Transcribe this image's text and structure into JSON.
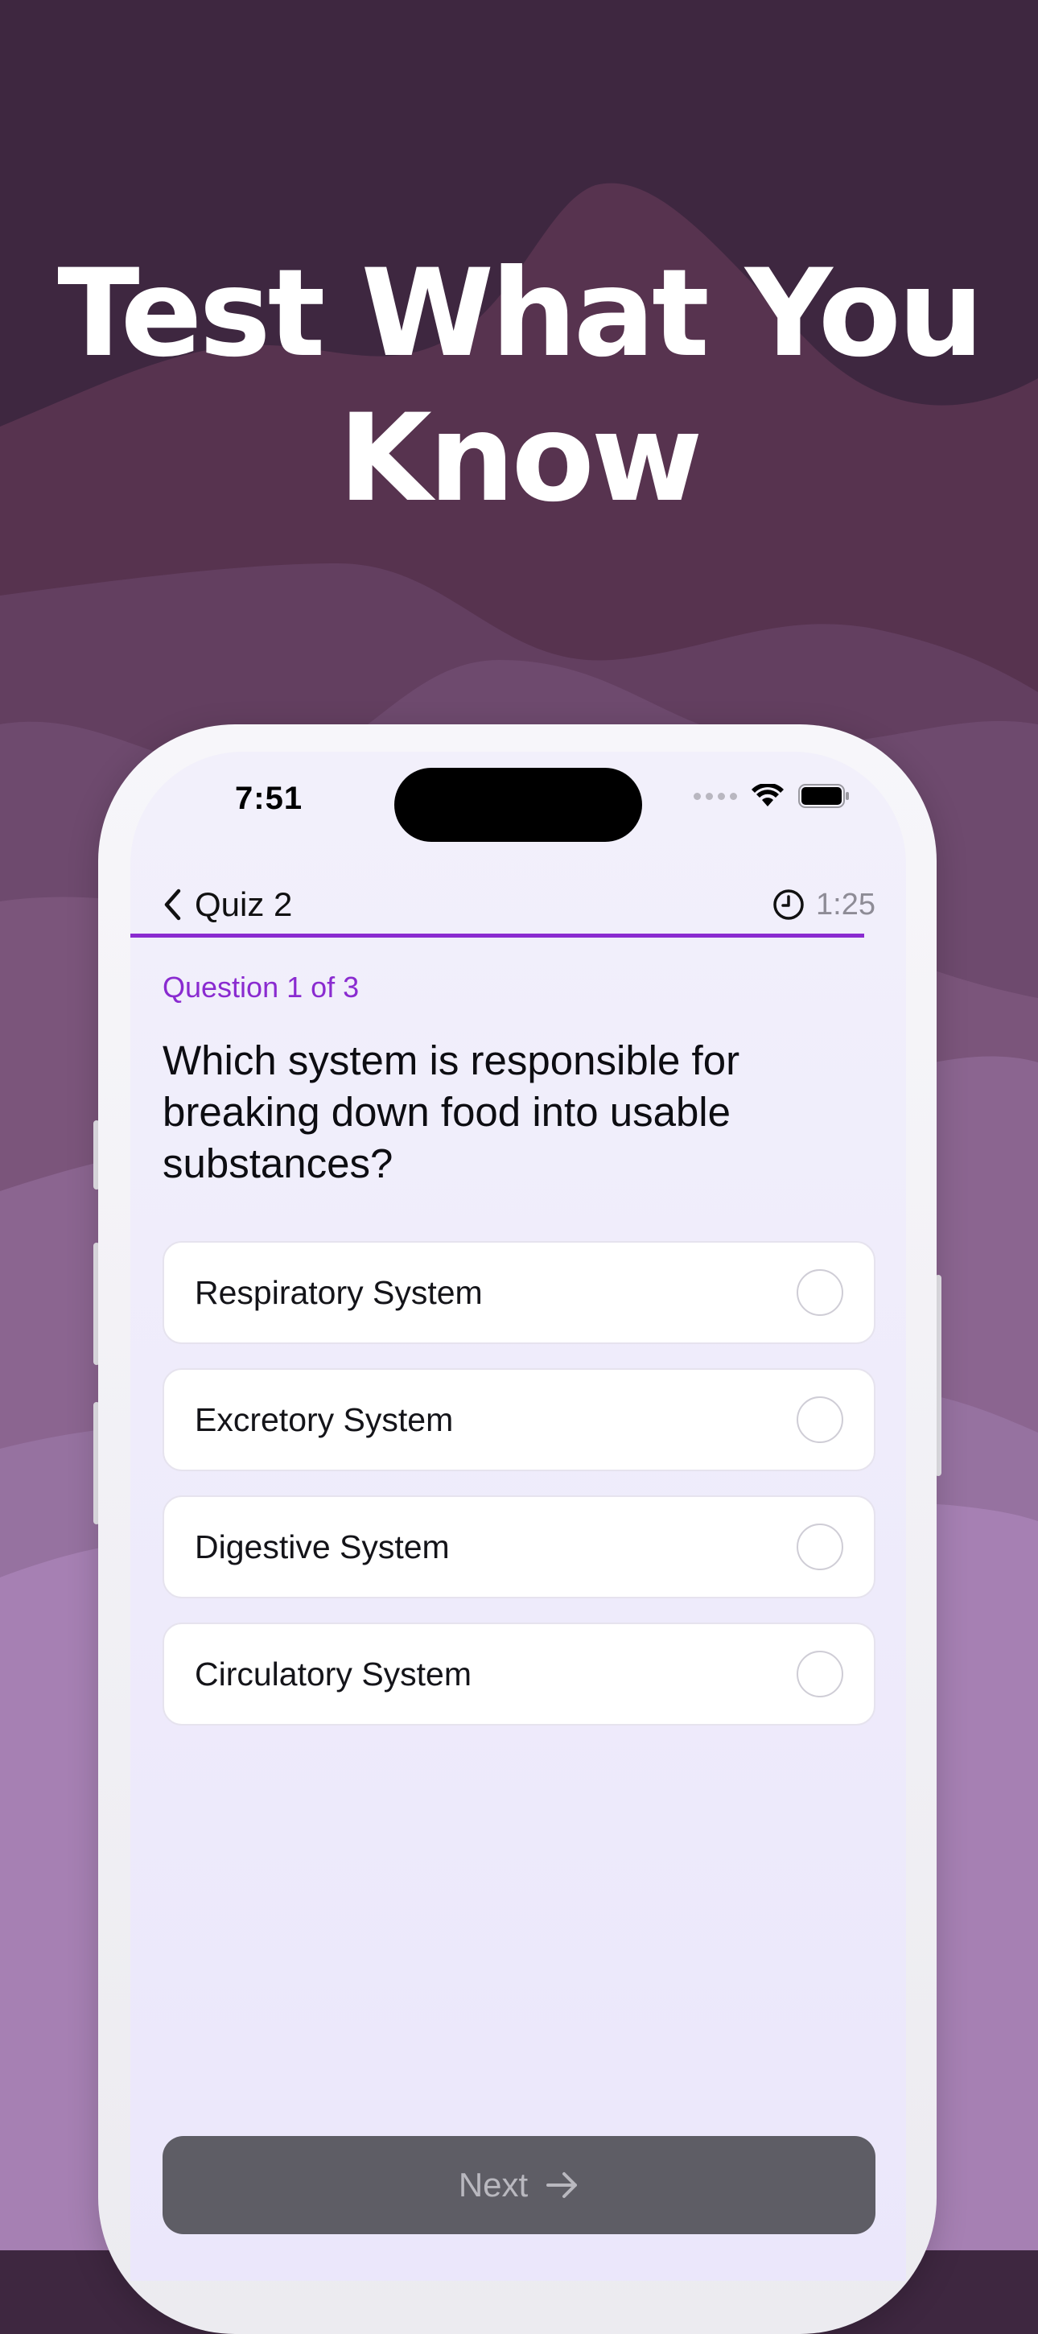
{
  "headline": {
    "line1": "Test What You",
    "line2": "Know"
  },
  "status_bar": {
    "time": "7:51",
    "icons": [
      "cellular-dots-icon",
      "wifi-icon",
      "battery-icon"
    ]
  },
  "nav": {
    "back_icon": "chevron-left-icon",
    "back_label": "Quiz 2",
    "timer_icon": "clock-icon",
    "timer_label": "1:25"
  },
  "progress": {
    "fraction": 1.0
  },
  "quiz": {
    "question_count": "Question 1 of 3",
    "question": "Which system is responsible for breaking down food into usable substances?",
    "options": [
      {
        "label": "Respiratory System",
        "selected": false
      },
      {
        "label": "Excretory System",
        "selected": false
      },
      {
        "label": "Digestive System",
        "selected": false
      },
      {
        "label": "Circulatory System",
        "selected": false
      }
    ]
  },
  "footer": {
    "next_label": "Next",
    "next_icon": "arrow-right-icon"
  },
  "colors": {
    "accent": "#8a2bd0",
    "background_dark": "#3e2740",
    "background_light": "#a880b4",
    "button_disabled": "#5e5d65"
  }
}
